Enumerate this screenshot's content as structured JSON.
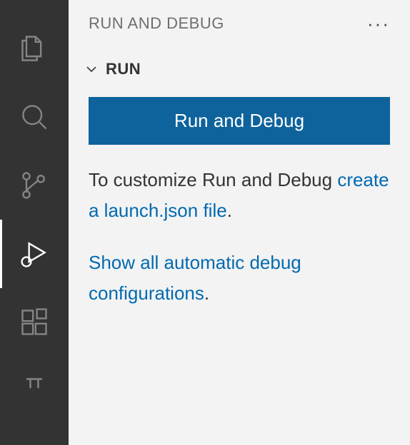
{
  "sidebar": {
    "title": "RUN AND DEBUG"
  },
  "section": {
    "title": "RUN"
  },
  "runButton": {
    "label": "Run and Debug"
  },
  "description": {
    "prefix": "To customize Run and Debug ",
    "linkText": "create a launch.json file",
    "suffix": "."
  },
  "showAll": {
    "linkText": "Show all automatic debug configurations",
    "suffix": "."
  }
}
